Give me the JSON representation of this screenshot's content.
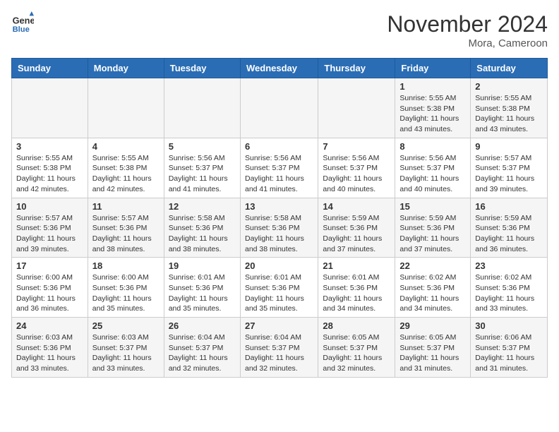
{
  "header": {
    "logo_line1": "General",
    "logo_line2": "Blue",
    "month_title": "November 2024",
    "location": "Mora, Cameroon"
  },
  "weekdays": [
    "Sunday",
    "Monday",
    "Tuesday",
    "Wednesday",
    "Thursday",
    "Friday",
    "Saturday"
  ],
  "weeks": [
    [
      {
        "day": "",
        "info": ""
      },
      {
        "day": "",
        "info": ""
      },
      {
        "day": "",
        "info": ""
      },
      {
        "day": "",
        "info": ""
      },
      {
        "day": "",
        "info": ""
      },
      {
        "day": "1",
        "info": "Sunrise: 5:55 AM\nSunset: 5:38 PM\nDaylight: 11 hours\nand 43 minutes."
      },
      {
        "day": "2",
        "info": "Sunrise: 5:55 AM\nSunset: 5:38 PM\nDaylight: 11 hours\nand 43 minutes."
      }
    ],
    [
      {
        "day": "3",
        "info": "Sunrise: 5:55 AM\nSunset: 5:38 PM\nDaylight: 11 hours\nand 42 minutes."
      },
      {
        "day": "4",
        "info": "Sunrise: 5:55 AM\nSunset: 5:38 PM\nDaylight: 11 hours\nand 42 minutes."
      },
      {
        "day": "5",
        "info": "Sunrise: 5:56 AM\nSunset: 5:37 PM\nDaylight: 11 hours\nand 41 minutes."
      },
      {
        "day": "6",
        "info": "Sunrise: 5:56 AM\nSunset: 5:37 PM\nDaylight: 11 hours\nand 41 minutes."
      },
      {
        "day": "7",
        "info": "Sunrise: 5:56 AM\nSunset: 5:37 PM\nDaylight: 11 hours\nand 40 minutes."
      },
      {
        "day": "8",
        "info": "Sunrise: 5:56 AM\nSunset: 5:37 PM\nDaylight: 11 hours\nand 40 minutes."
      },
      {
        "day": "9",
        "info": "Sunrise: 5:57 AM\nSunset: 5:37 PM\nDaylight: 11 hours\nand 39 minutes."
      }
    ],
    [
      {
        "day": "10",
        "info": "Sunrise: 5:57 AM\nSunset: 5:36 PM\nDaylight: 11 hours\nand 39 minutes."
      },
      {
        "day": "11",
        "info": "Sunrise: 5:57 AM\nSunset: 5:36 PM\nDaylight: 11 hours\nand 38 minutes."
      },
      {
        "day": "12",
        "info": "Sunrise: 5:58 AM\nSunset: 5:36 PM\nDaylight: 11 hours\nand 38 minutes."
      },
      {
        "day": "13",
        "info": "Sunrise: 5:58 AM\nSunset: 5:36 PM\nDaylight: 11 hours\nand 38 minutes."
      },
      {
        "day": "14",
        "info": "Sunrise: 5:59 AM\nSunset: 5:36 PM\nDaylight: 11 hours\nand 37 minutes."
      },
      {
        "day": "15",
        "info": "Sunrise: 5:59 AM\nSunset: 5:36 PM\nDaylight: 11 hours\nand 37 minutes."
      },
      {
        "day": "16",
        "info": "Sunrise: 5:59 AM\nSunset: 5:36 PM\nDaylight: 11 hours\nand 36 minutes."
      }
    ],
    [
      {
        "day": "17",
        "info": "Sunrise: 6:00 AM\nSunset: 5:36 PM\nDaylight: 11 hours\nand 36 minutes."
      },
      {
        "day": "18",
        "info": "Sunrise: 6:00 AM\nSunset: 5:36 PM\nDaylight: 11 hours\nand 35 minutes."
      },
      {
        "day": "19",
        "info": "Sunrise: 6:01 AM\nSunset: 5:36 PM\nDaylight: 11 hours\nand 35 minutes."
      },
      {
        "day": "20",
        "info": "Sunrise: 6:01 AM\nSunset: 5:36 PM\nDaylight: 11 hours\nand 35 minutes."
      },
      {
        "day": "21",
        "info": "Sunrise: 6:01 AM\nSunset: 5:36 PM\nDaylight: 11 hours\nand 34 minutes."
      },
      {
        "day": "22",
        "info": "Sunrise: 6:02 AM\nSunset: 5:36 PM\nDaylight: 11 hours\nand 34 minutes."
      },
      {
        "day": "23",
        "info": "Sunrise: 6:02 AM\nSunset: 5:36 PM\nDaylight: 11 hours\nand 33 minutes."
      }
    ],
    [
      {
        "day": "24",
        "info": "Sunrise: 6:03 AM\nSunset: 5:36 PM\nDaylight: 11 hours\nand 33 minutes."
      },
      {
        "day": "25",
        "info": "Sunrise: 6:03 AM\nSunset: 5:37 PM\nDaylight: 11 hours\nand 33 minutes."
      },
      {
        "day": "26",
        "info": "Sunrise: 6:04 AM\nSunset: 5:37 PM\nDaylight: 11 hours\nand 32 minutes."
      },
      {
        "day": "27",
        "info": "Sunrise: 6:04 AM\nSunset: 5:37 PM\nDaylight: 11 hours\nand 32 minutes."
      },
      {
        "day": "28",
        "info": "Sunrise: 6:05 AM\nSunset: 5:37 PM\nDaylight: 11 hours\nand 32 minutes."
      },
      {
        "day": "29",
        "info": "Sunrise: 6:05 AM\nSunset: 5:37 PM\nDaylight: 11 hours\nand 31 minutes."
      },
      {
        "day": "30",
        "info": "Sunrise: 6:06 AM\nSunset: 5:37 PM\nDaylight: 11 hours\nand 31 minutes."
      }
    ]
  ]
}
